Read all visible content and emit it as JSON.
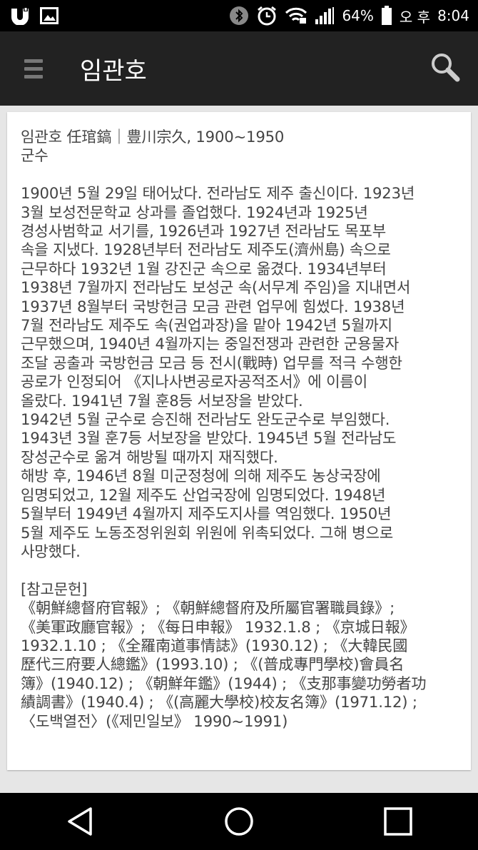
{
  "status_bar": {
    "battery_percent": "64%",
    "ampm": "오 후",
    "time": "8:04",
    "icons": [
      "u-plus-icon",
      "image-icon",
      "bluetooth-icon",
      "alarm-icon",
      "wifi-icon",
      "signal-icon",
      "battery-icon"
    ]
  },
  "app_bar": {
    "title": "임관호",
    "menu_icon": "hamburger-menu-icon",
    "search_icon": "search-icon"
  },
  "article": {
    "heading_lines": [
      "임관호 任琯鎬｜豊川宗久, 1900~1950",
      "군수"
    ],
    "body_lines": [
      "1900년 5월 29일 태어났다. 전라남도 제주 출신이다. 1923년",
      "3월 보성전문학교 상과를 졸업했다. 1924년과 1925년",
      "경성사범학교 서기를, 1926년과 1927년 전라남도 목포부",
      "속을 지냈다. 1928년부터 전라남도 제주도(濟州島) 속으로",
      "근무하다 1932년 1월 강진군 속으로 옮겼다. 1934년부터",
      "1938년 7월까지 전라남도 보성군 속(서무계 주임)을 지내면서",
      "1937년 8월부터 국방헌금 모금 관련 업무에 힘썼다. 1938년",
      "7월 전라남도 제주도 속(권업과장)을 맡아 1942년 5월까지",
      "근무했으며, 1940년 4월까지는 중일전쟁과 관련한 군용물자",
      "조달 공출과 국방헌금 모금 등 전시(戰時) 업무를 적극 수행한",
      "공로가 인정되어 《지나사변공로자공적조서》에 이름이",
      "올랐다. 1941년 7월 훈8등 서보장을 받았다.",
      "1942년 5월 군수로 승진해 전라남도 완도군수로 부임했다.",
      "1943년 3월 훈7등 서보장을 받았다. 1945년 5월 전라남도",
      "장성군수로 옮겨 해방될 때까지 재직했다.",
      "해방 후, 1946년 8월 미군정청에 의해 제주도 농상국장에",
      "임명되었고, 12월 제주도 산업국장에 임명되었다. 1948년",
      "5월부터 1949년 4월까지 제주도지사를 역임했다. 1950년",
      "5월 제주도 노동조정위원회 위원에 위촉되었다. 그해 병으로",
      "사망했다."
    ],
    "references_title": "[참고문헌]",
    "references_lines": [
      "《朝鮮總督府官報》; 《朝鮮總督府及所屬官署職員錄》;",
      "《美軍政廳官報》; 《每日申報》 1932.1.8 ; 《京城日報》",
      "1932.1.10 ; 《全羅南道事情誌》(1930.12) ; 《大韓民國",
      "歷代三府要人總鑑》(1993.10) ; 《(普成專門學校)會員名",
      "簿》(1940.12) ; 《朝鮮年鑑》(1944) ; 《支那事變功勞者功",
      "績調書》(1940.4) ; 《(高麗大學校)校友名簿》(1971.12) ;",
      "〈도백열전〉(《제민일보》 1990~1991)"
    ]
  },
  "nav_bar": {
    "back_icon": "back-triangle-icon",
    "home_icon": "home-circle-icon",
    "recents_icon": "recents-square-icon"
  }
}
